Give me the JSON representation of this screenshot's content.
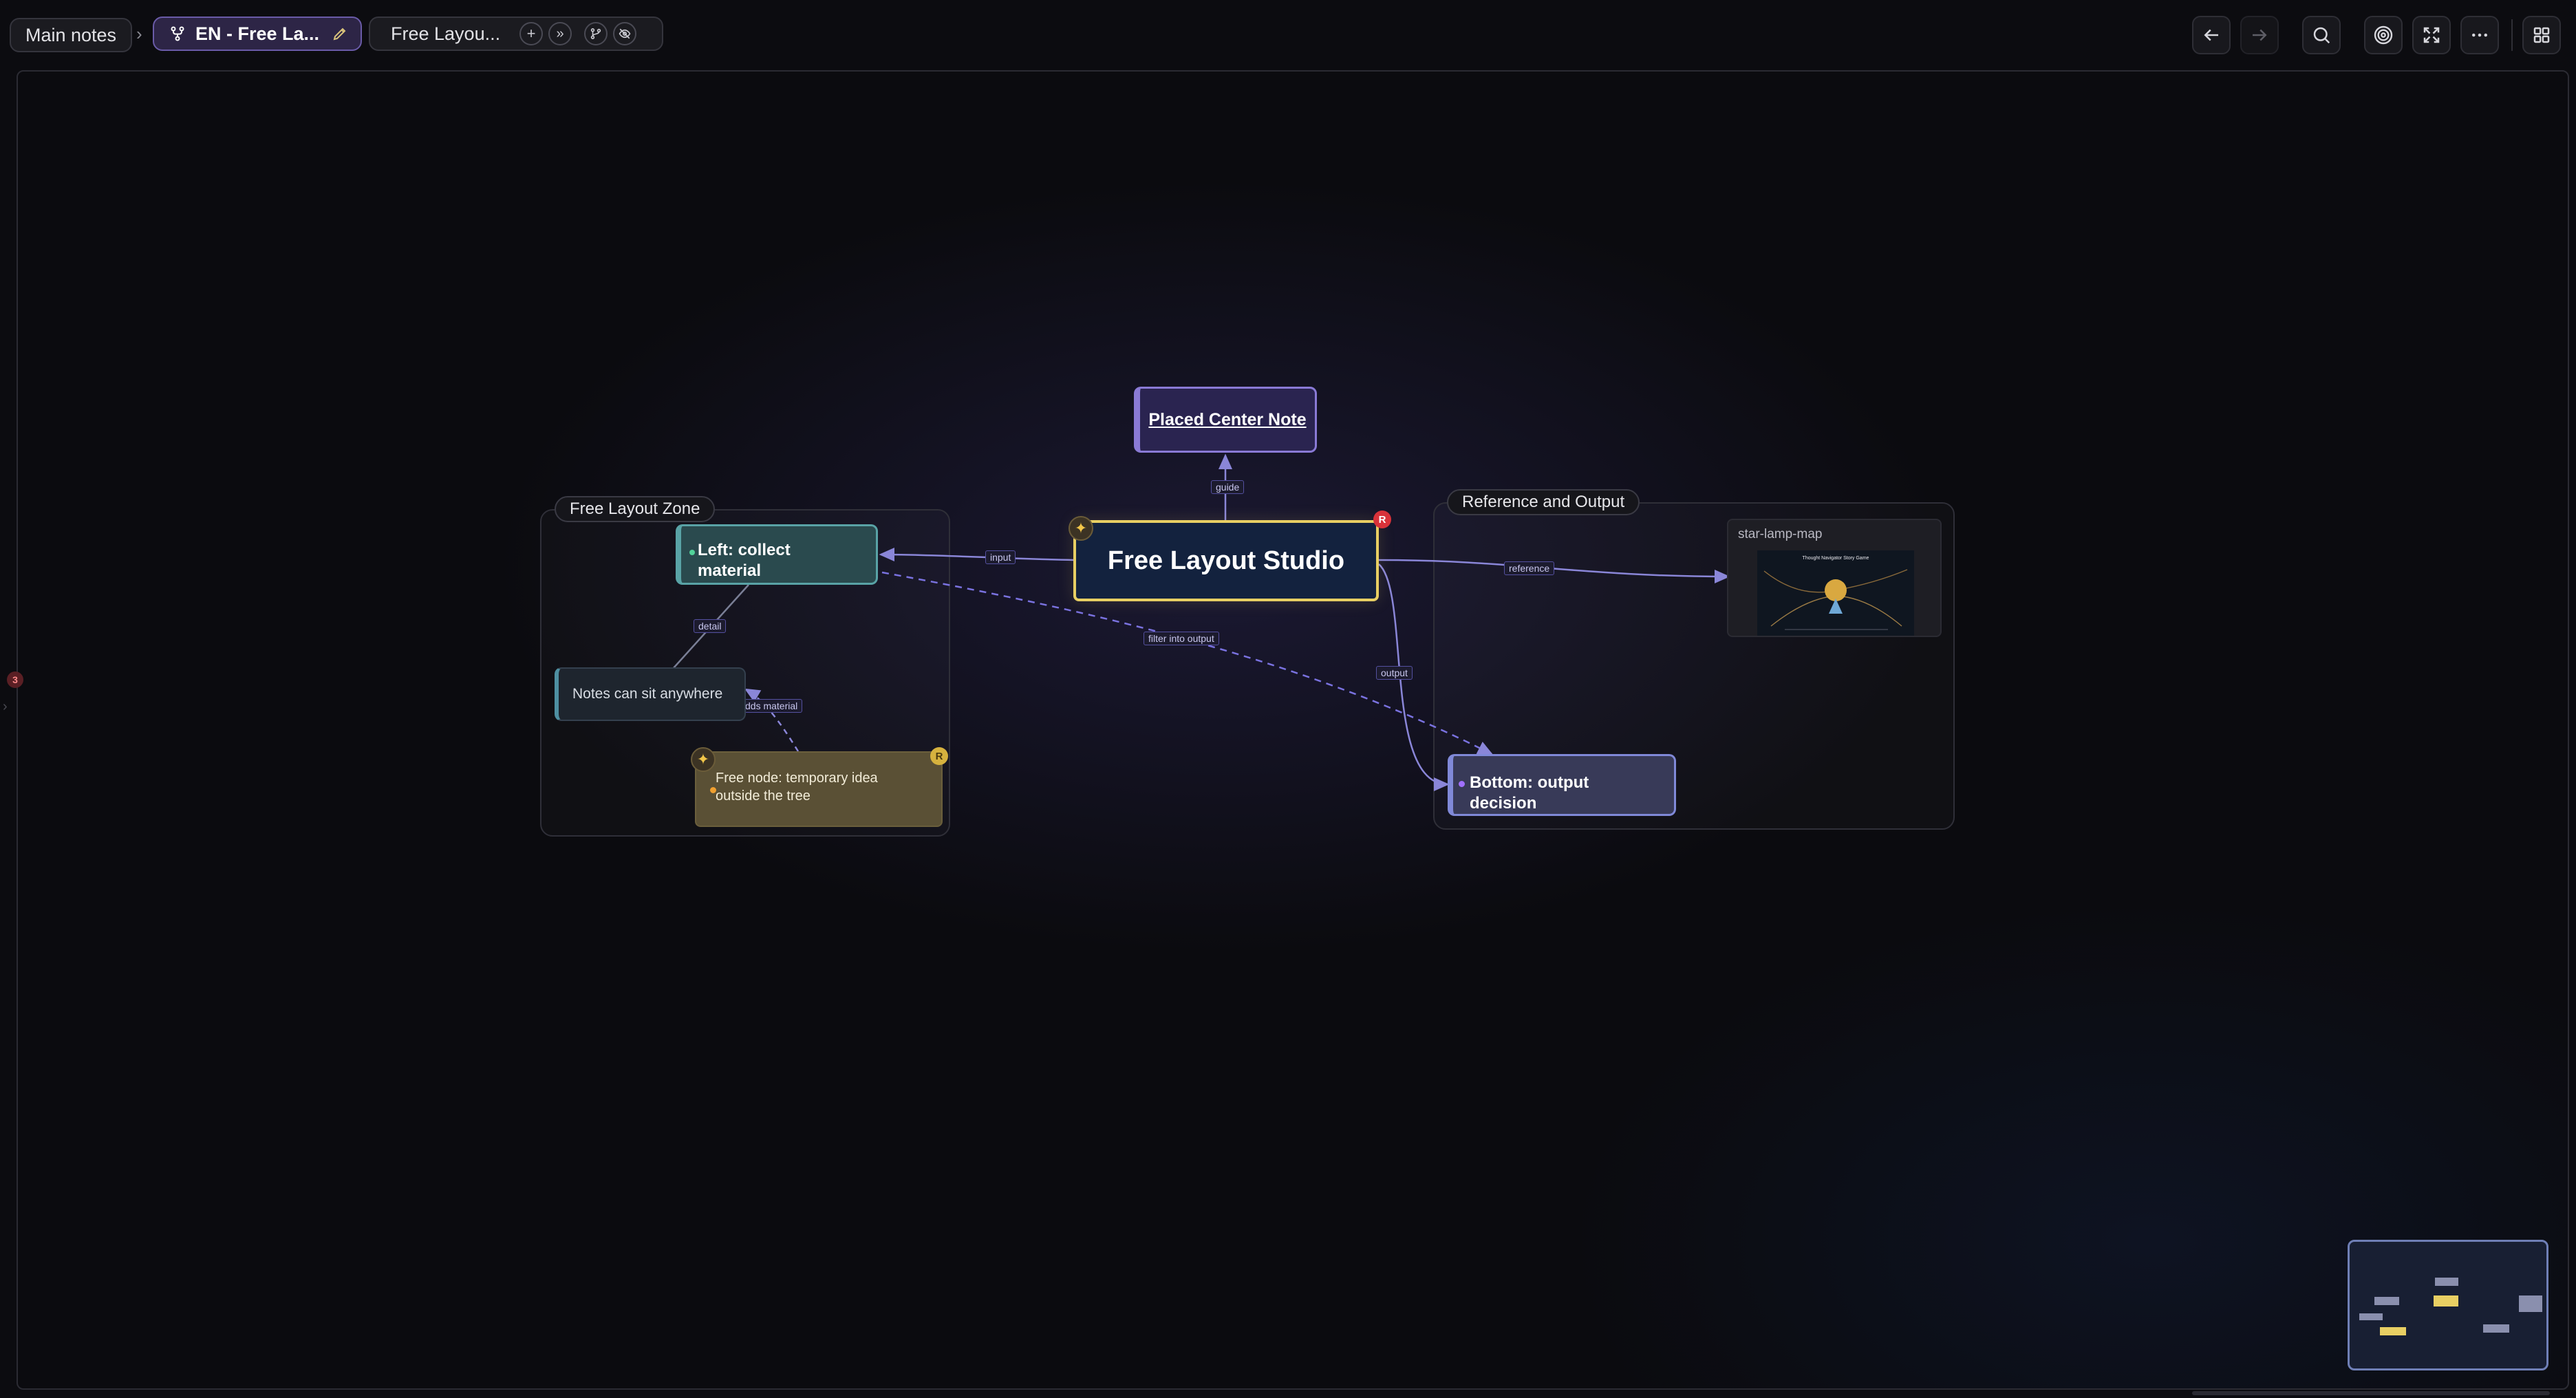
{
  "breadcrumb": {
    "main": "Main notes",
    "separator": "›",
    "current_map": "EN - Free La...",
    "view": "Free Layou..."
  },
  "canvas": {
    "zones": {
      "left": "Free Layout Zone",
      "right": "Reference and Output"
    },
    "nodes": {
      "center": "Free Layout Studio",
      "top": "Placed Center Note",
      "left": "Left: collect material",
      "notes": "Notes can sit anywhere",
      "free": "Free node: temporary idea outside the tree",
      "bottom": "Bottom: output decision",
      "image_title": "star-lamp-map",
      "image_caption": "Thought Navigator Story Game"
    },
    "edges": {
      "guide": "guide",
      "input": "input",
      "detail": "detail",
      "adds_material": "dds material",
      "filter": "filter into output",
      "output": "output",
      "reference": "reference"
    },
    "badges": {
      "root": "R",
      "free": "R",
      "side": "3"
    }
  },
  "colors": {
    "accent": "#7a6ad0",
    "center_border": "#e8cf63",
    "left_node": "#2a4a4e",
    "free_node": "#5a5035",
    "bottom_node": "#383a58",
    "edge": "#8a86d8"
  },
  "icons": {
    "map": "branch-icon",
    "rename": "pencil-icon",
    "add": "plus-icon",
    "more": "double-chevron-icon",
    "branch": "branch-icon",
    "hide": "eye-off-icon",
    "back": "arrow-left-icon",
    "forward": "arrow-right-icon",
    "search": "search-icon",
    "focus": "target-icon",
    "fullscreen": "fullscreen-icon",
    "menu": "more-icon",
    "layout": "grid-icon",
    "spark": "sparkle-icon"
  }
}
